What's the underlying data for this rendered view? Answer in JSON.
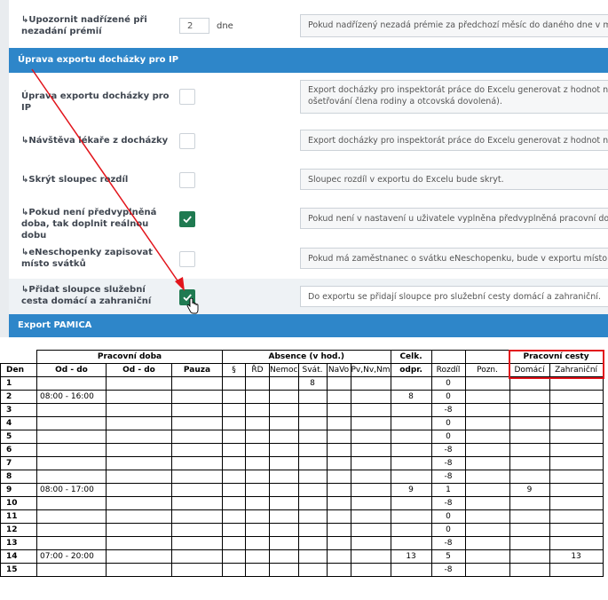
{
  "settings": {
    "row_notify": {
      "label": "↳Upozornit nadřízené při nezadání prémií",
      "value": "2",
      "unit": "dne",
      "description": "Pokud nadřízený nezadá prémie za předchozí měsíc do daného dne v měsíci, z"
    },
    "section_ip": {
      "title": "Úprava exportu docházky pro IP"
    },
    "rows": [
      {
        "label": "Úprava exportu docházky pro IP",
        "checked": false,
        "description_line1": "Export docházky pro inspektorát práce do Excelu generovat z hodnot nastaven",
        "description_line2": "ošetřování člena rodiny a otcovská dovolená)."
      },
      {
        "label": "↳Návštěva lékaře z docházky",
        "checked": false,
        "description_line1": "Export docházky pro inspektorát práce do Excelu generovat z hodnot nastaven",
        "description_line2": ""
      },
      {
        "label": "↳Skrýt sloupec rozdíl",
        "checked": false,
        "description_line1": "Sloupec rozdíl v exportu do Excelu bude skryt.",
        "description_line2": ""
      },
      {
        "label": "↳Pokud není předvyplněná doba, tak doplnit reálnou dobu",
        "checked": true,
        "description_line1": "Pokud není v nastavení u uživatele vyplněna předvyplněná pracovní doba, dop",
        "description_line2": ""
      },
      {
        "label": "↳eNeschopenky zapisovat místo svátků",
        "checked": false,
        "description_line1": "Pokud má zaměstnanec o svátku eNeschopenku, bude v exportu místo svátku",
        "description_line2": ""
      },
      {
        "label": "↳Přidat sloupce služební cesta domácí a zahraniční",
        "checked": true,
        "description_line1": "Do exportu se přidají sloupce pro služební cesty domácí a zahraniční.",
        "description_line2": ""
      }
    ],
    "section_pamica": {
      "title": "Export PAMICA"
    },
    "colors": {
      "section": "#2e86c9",
      "check": "#1f7a51",
      "arrow": "#e2141b"
    }
  },
  "attendance": {
    "headers": {
      "den": "Den",
      "pracovni_doba": "Pracovní doba",
      "od_do_1": "Od - do",
      "od_do_2": "Od - do",
      "pauza": "Pauza",
      "absence": "Absence (v hod.)",
      "paragraph": "§",
      "rd": "ŘD",
      "nemoc": "Nemoc",
      "svat": "Svát.",
      "navo": "NaVo",
      "pvnvnm": "Pv,Nv,Nm",
      "celk_1": "Celk.",
      "celk_2": "odpr.",
      "rozdil": "Rozdíl",
      "pozn": "Pozn.",
      "pracovni_cesty": "Pracovní cesty",
      "domaci": "Domácí",
      "zahranicni": "Zahraniční"
    },
    "rows": [
      {
        "den": "1",
        "od_do": "",
        "svat": "8",
        "celk": "",
        "rozdil": "0",
        "domaci": "",
        "zahranicni": ""
      },
      {
        "den": "2",
        "od_do": "08:00 - 16:00",
        "svat": "",
        "celk": "8",
        "rozdil": "0",
        "domaci": "",
        "zahranicni": ""
      },
      {
        "den": "3",
        "od_do": "",
        "svat": "",
        "celk": "",
        "rozdil": "-8",
        "domaci": "",
        "zahranicni": ""
      },
      {
        "den": "4",
        "od_do": "",
        "svat": "",
        "celk": "",
        "rozdil": "0",
        "domaci": "",
        "zahranicni": ""
      },
      {
        "den": "5",
        "od_do": "",
        "svat": "",
        "celk": "",
        "rozdil": "0",
        "domaci": "",
        "zahranicni": ""
      },
      {
        "den": "6",
        "od_do": "",
        "svat": "",
        "celk": "",
        "rozdil": "-8",
        "domaci": "",
        "zahranicni": ""
      },
      {
        "den": "7",
        "od_do": "",
        "svat": "",
        "celk": "",
        "rozdil": "-8",
        "domaci": "",
        "zahranicni": ""
      },
      {
        "den": "8",
        "od_do": "",
        "svat": "",
        "celk": "",
        "rozdil": "-8",
        "domaci": "",
        "zahranicni": ""
      },
      {
        "den": "9",
        "od_do": "08:00 - 17:00",
        "svat": "",
        "celk": "9",
        "rozdil": "1",
        "domaci": "9",
        "zahranicni": ""
      },
      {
        "den": "10",
        "od_do": "",
        "svat": "",
        "celk": "",
        "rozdil": "-8",
        "domaci": "",
        "zahranicni": ""
      },
      {
        "den": "11",
        "od_do": "",
        "svat": "",
        "celk": "",
        "rozdil": "0",
        "domaci": "",
        "zahranicni": ""
      },
      {
        "den": "12",
        "od_do": "",
        "svat": "",
        "celk": "",
        "rozdil": "0",
        "domaci": "",
        "zahranicni": ""
      },
      {
        "den": "13",
        "od_do": "",
        "svat": "",
        "celk": "",
        "rozdil": "-8",
        "domaci": "",
        "zahranicni": ""
      },
      {
        "den": "14",
        "od_do": "07:00 - 20:00",
        "svat": "",
        "celk": "13",
        "rozdil": "5",
        "domaci": "",
        "zahranicni": "13"
      },
      {
        "den": "15",
        "od_do": "",
        "svat": "",
        "celk": "",
        "rozdil": "-8",
        "domaci": "",
        "zahranicni": ""
      }
    ]
  }
}
